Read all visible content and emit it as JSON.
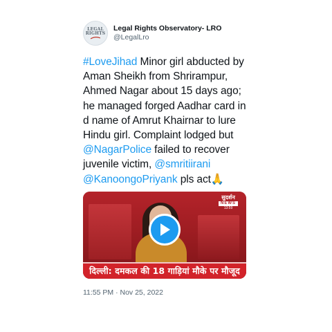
{
  "author": {
    "display_name": "Legal Rights Observatory- LRO",
    "handle": "@LegalLro",
    "avatar_text_line1": "LEGAL",
    "avatar_text_line2": "RIGHTS"
  },
  "tweet": {
    "segments": [
      {
        "type": "hashtag",
        "text": "#LoveJihad"
      },
      {
        "type": "text",
        "text": " Minor girl abducted by Aman Sheikh from Shrirampur, Ahmed Nagar about 15 days ago; he managed forged Aadhar card in d name of Amrut Khairnar to lure Hindu girl. Complaint lodged but "
      },
      {
        "type": "mention",
        "text": "@NagarPolice"
      },
      {
        "type": "text",
        "text": " failed to recover juvenile victim, "
      },
      {
        "type": "mention",
        "text": "@smritiirani"
      },
      {
        "type": "text",
        "text": " "
      },
      {
        "type": "mention",
        "text": "@KanoongoPriyank"
      },
      {
        "type": "text",
        "text": " pls act🙏"
      }
    ],
    "timestamp": "11:55 PM · Nov 25, 2022"
  },
  "media": {
    "type": "video",
    "channel_logo_top": "सुदर्शन",
    "channel_logo_bottom": "NEWS",
    "channel_logo_time": "13:59",
    "ticker": "दिल्ली: दमकल की 18 गाड़ियां मौके पर मौजूद",
    "play_icon": "play-icon",
    "play_color": "#1d9bf0"
  },
  "colors": {
    "link": "#1d9bf0",
    "text": "#0f1419",
    "secondary": "#536471"
  }
}
